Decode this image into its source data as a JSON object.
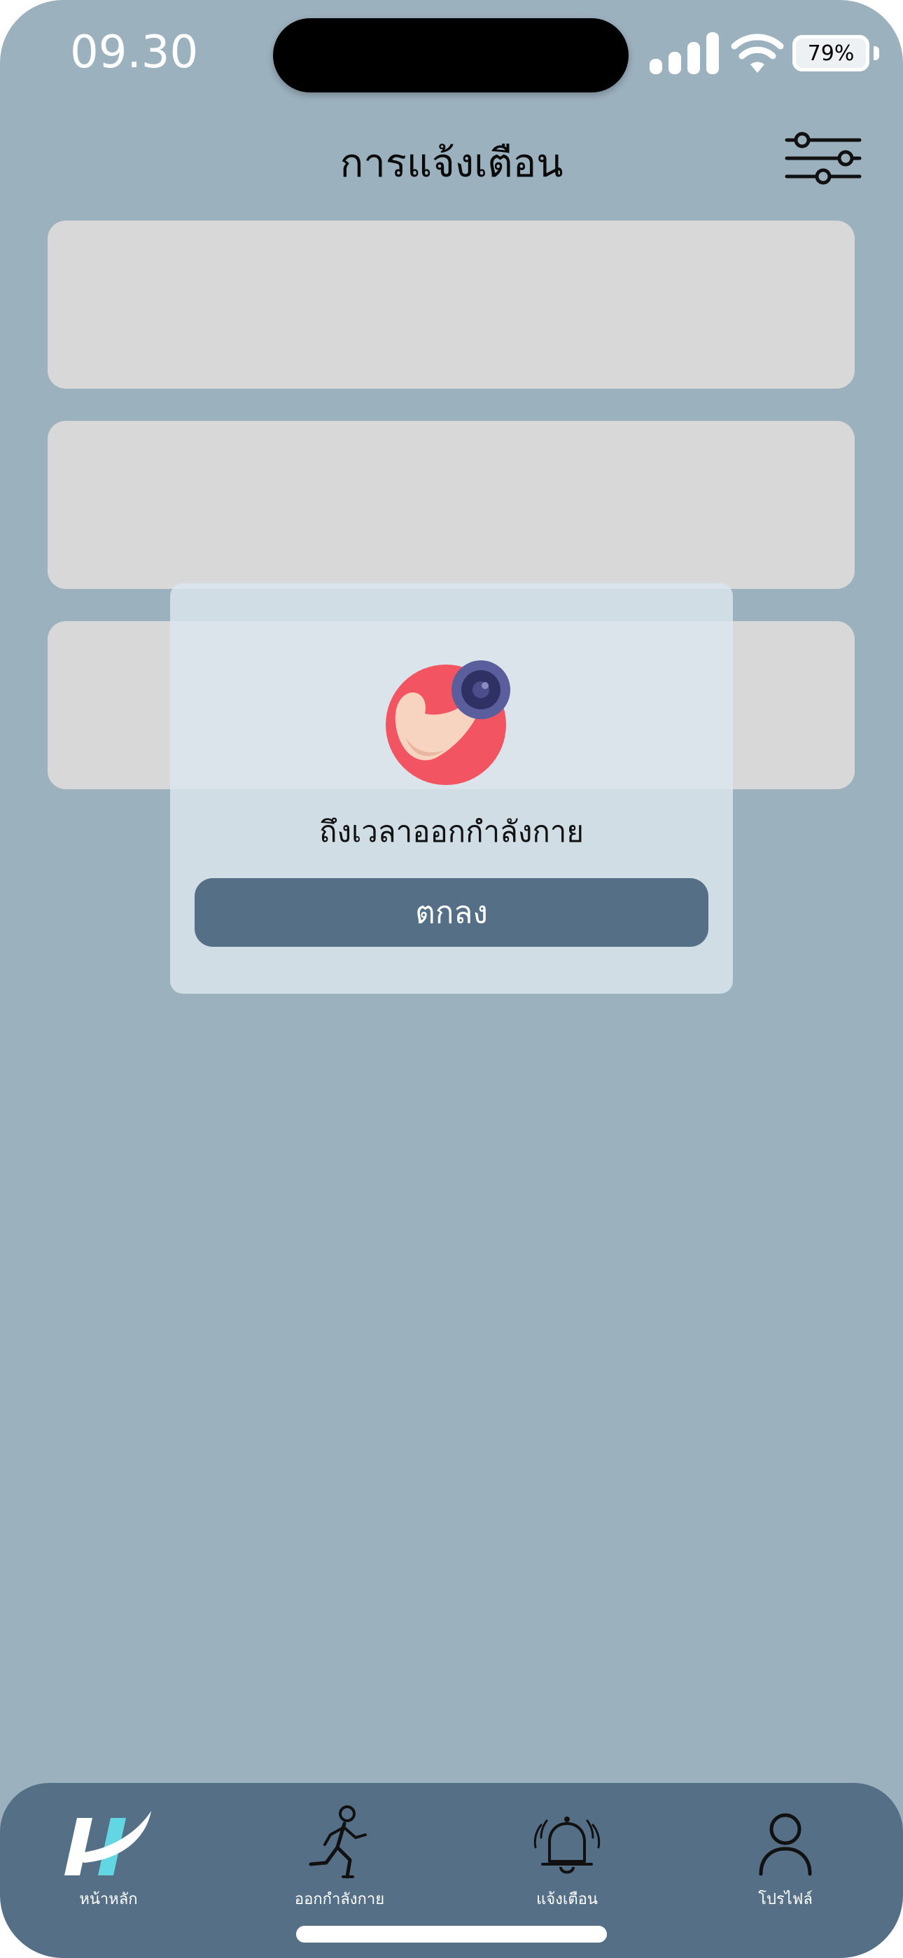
{
  "status_bar": {
    "time": "09.30",
    "battery_percent": "79%"
  },
  "header": {
    "title": "การแจ้งเตือน",
    "filter_icon": "sliders-icon"
  },
  "notifications": {
    "placeholder_cards": 3
  },
  "modal": {
    "icon": "flexed-arm-dumbbell-icon",
    "message": "ถึงเวลาออกกำลังกาย",
    "ok_label": "ตกลง"
  },
  "bottom_nav": {
    "items": [
      {
        "label": "หน้าหลัก",
        "icon": "app-logo-icon"
      },
      {
        "label": "ออกกำลังกาย",
        "icon": "running-person-icon"
      },
      {
        "label": "แจ้งเตือน",
        "icon": "bell-icon"
      },
      {
        "label": "โปรไฟล์",
        "icon": "person-icon"
      }
    ]
  },
  "colors": {
    "background": "#9cb1be",
    "card": "#d8d8d8",
    "accent": "#546f86",
    "modal": "#dce7ee",
    "icon_red": "#f25462",
    "dumbbell": "#4b4e8a"
  }
}
